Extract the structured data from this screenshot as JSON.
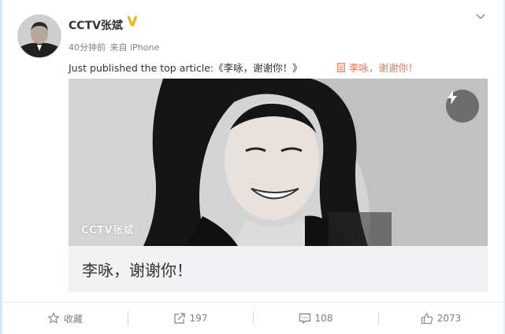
{
  "post": {
    "author_name": "CCTV张斌",
    "verified_mark": "V",
    "time_ago": "40分钟前",
    "source": "来自 iPhone",
    "text": "Just published the top article:《李咏，谢谢你！》",
    "article_link": "李咏，谢谢你！",
    "article_icon": "document-icon"
  },
  "card": {
    "watermark": "CCTV张斌",
    "title": "李咏，谢谢你！",
    "flash_icon": "lightning-icon"
  },
  "actions": {
    "favorite_label": "收藏",
    "repost_count": "197",
    "comment_count": "108",
    "like_count": "2073"
  },
  "colors": {
    "link_orange": "#eb7350",
    "verified_gold": "#f6b200",
    "muted_gray": "#808080"
  }
}
